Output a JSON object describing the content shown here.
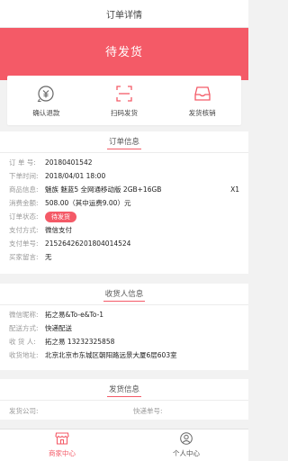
{
  "header": {
    "title": "订单详情"
  },
  "banner": {
    "status": "待发货"
  },
  "actions": [
    {
      "label": "确认退款",
      "icon": "refund-icon"
    },
    {
      "label": "扫码发货",
      "icon": "scan-icon"
    },
    {
      "label": "发货核销",
      "icon": "tray-icon"
    }
  ],
  "order_info": {
    "title": "订单信息",
    "rows": [
      {
        "key": "订 单 号:",
        "value": "20180401542"
      },
      {
        "key": "下单时间:",
        "value": "2018/04/01 18:00"
      },
      {
        "key": "商品信息:",
        "value": "魅族 魅蓝5 全网通移动版 2GB+16GB",
        "qty": "X1"
      },
      {
        "key": "消费金额:",
        "value": "508.00（其中运费9.00）元"
      },
      {
        "key": "订单状态:",
        "value": "待发货"
      },
      {
        "key": "支付方式:",
        "value": "微信支付"
      },
      {
        "key": "支付单号:",
        "value": "21526426201804014524"
      },
      {
        "key": "买家留言:",
        "value": "无"
      }
    ]
  },
  "recipient_info": {
    "title": "收货人信息",
    "rows": [
      {
        "key": "微信昵称:",
        "value": "拓之易&To-e&To-1"
      },
      {
        "key": "配送方式:",
        "value": "快递配送"
      },
      {
        "key": "收 货 人:",
        "value": "拓之易 13232325858"
      },
      {
        "key": "收货地址:",
        "value": "北京北京市东城区朝阳路远景大厦6层603室"
      }
    ]
  },
  "shipping_info": {
    "title": "发货信息",
    "company_label": "发货公司:",
    "tracking_label": "快递单号:"
  },
  "tabbar": [
    {
      "label": "商家中心",
      "icon": "store-icon"
    },
    {
      "label": "个人中心",
      "icon": "user-icon"
    }
  ],
  "colors": {
    "accent": "#f45a67",
    "background": "#f2f2f2"
  }
}
